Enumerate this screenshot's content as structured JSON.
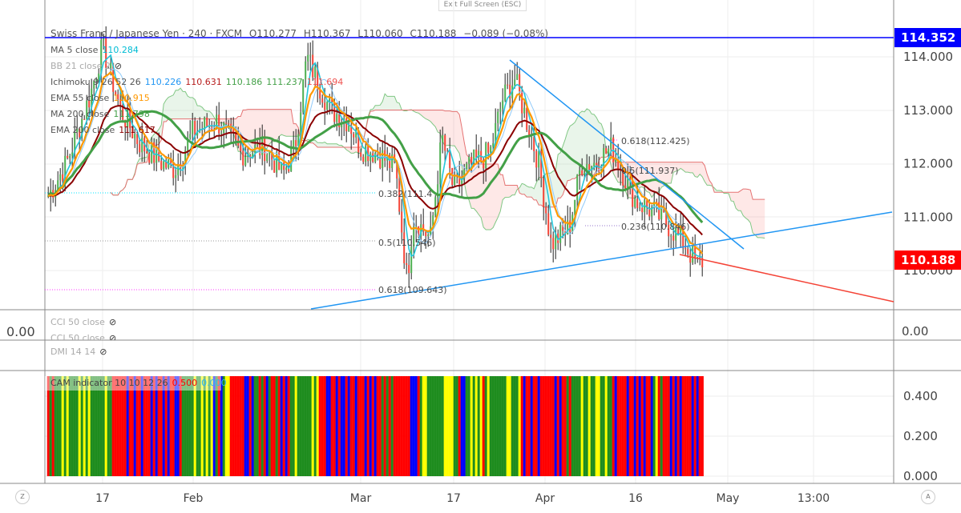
{
  "toolbar": {
    "exit_fullscreen": "Exit Full Screen (ESC)",
    "left_circle": "Z",
    "right_circle": "A"
  },
  "header": {
    "title": "Swiss Franc / Japanese Yen · 240 · FXCM",
    "open": "O110.277",
    "high": "H110.367",
    "low": "L110.060",
    "close": "C110.188",
    "change": "−0.089 (−0.08%)"
  },
  "indicators": [
    {
      "label": "MA 5 close",
      "values": [
        "110.284"
      ],
      "colors": [
        "#00bcd4"
      ]
    },
    {
      "label": "BB 21 close 2",
      "values": [],
      "hidden": true
    },
    {
      "label": "Ichimoku 9 26 52 26",
      "values": [
        "110.226",
        "110.631",
        "110.186",
        "111.237",
        "111.694"
      ],
      "colors": [
        "#2196f3",
        "#b71c1c",
        "#43a047",
        "#43a047",
        "#ef5350"
      ]
    },
    {
      "label": "EMA 55 close",
      "values": [
        "110.915"
      ],
      "colors": [
        "#ff9800"
      ]
    },
    {
      "label": "MA 200 close",
      "values": [
        "111.798"
      ],
      "colors": [
        "#43a047"
      ]
    },
    {
      "label": "EMA 200 close",
      "values": [
        "111.617"
      ],
      "colors": [
        "#8b0000"
      ]
    }
  ],
  "panes": {
    "cci1": "CCI 50 close",
    "cci2": "CCI 50 close",
    "dmi": "DMI 14 14",
    "cam": {
      "label": "CAM indicator 10 10 12 26",
      "v1": "0.500",
      "v2": "0.000"
    },
    "cci_axis": "0.00"
  },
  "price_tags": {
    "line": "114.352",
    "last": "110.188",
    "line_color": "#0000ff",
    "last_color": "#ff0000"
  },
  "fib_labels": [
    {
      "text": "0.382(111.4",
      "color": "#00e5ff"
    },
    {
      "text": "0.5(110.546)",
      "color": "#33dd33"
    },
    {
      "text": "0.618(109.643)",
      "color": "#ff33ff"
    },
    {
      "text": "0.618(112.425)",
      "color": "#ff33ff"
    },
    {
      "text": "0.5(111.937)",
      "color": "#33dd33"
    },
    {
      "text": "0.236(110.846)",
      "color": "#9575cd"
    }
  ],
  "chart_data": {
    "type": "candlestick",
    "y_axis": {
      "ticks": [
        "114.000",
        "113.000",
        "112.000",
        "111.000",
        "110.000"
      ],
      "range": [
        109.3,
        114.6
      ]
    },
    "cam_axis": {
      "ticks": [
        "0.400",
        "0.200",
        "0.000"
      ]
    },
    "x_ticks": [
      "17",
      "Feb",
      "Mar",
      "17",
      "Apr",
      "16",
      "May",
      "13:00"
    ],
    "grid": true,
    "approx_close_path": [
      [
        "Jan 8",
        111.4
      ],
      [
        "Jan 11",
        112.0
      ],
      [
        "Jan 15",
        113.3
      ],
      [
        "Jan 17",
        114.2
      ],
      [
        "Jan 20",
        113.0
      ],
      [
        "Jan 23",
        112.4
      ],
      [
        "Jan 27",
        112.0
      ],
      [
        "Jan 29",
        111.9
      ],
      [
        "Feb 1",
        112.6
      ],
      [
        "Feb 5",
        112.8
      ],
      [
        "Feb 9",
        112.2
      ],
      [
        "Feb 13",
        112.3
      ],
      [
        "Feb 16",
        111.8
      ],
      [
        "Feb 18",
        112.3
      ],
      [
        "Feb 20",
        114.0
      ],
      [
        "Feb 22",
        113.5
      ],
      [
        "Feb 24",
        113.0
      ],
      [
        "Feb 27",
        112.8
      ],
      [
        "Mar 1",
        112.3
      ],
      [
        "Mar 4",
        112.2
      ],
      [
        "Mar 7",
        111.9
      ],
      [
        "Mar 9",
        109.8
      ],
      [
        "Mar 10",
        111.0
      ],
      [
        "Mar 13",
        110.6
      ],
      [
        "Mar 15",
        112.5
      ],
      [
        "Mar 17",
        111.5
      ],
      [
        "Mar 20",
        112.0
      ],
      [
        "Mar 23",
        112.2
      ],
      [
        "Mar 25",
        113.2
      ],
      [
        "Mar 27",
        113.6
      ],
      [
        "Mar 29",
        112.8
      ],
      [
        "Mar 31",
        112.0
      ],
      [
        "Apr 2",
        110.5
      ],
      [
        "Apr 5",
        110.8
      ],
      [
        "Apr 7",
        112.0
      ],
      [
        "Apr 9",
        112.0
      ],
      [
        "Apr 12",
        112.3
      ],
      [
        "Apr 14",
        111.8
      ],
      [
        "Apr 16",
        111.3
      ],
      [
        "Apr 19",
        111.1
      ],
      [
        "Apr 21",
        110.9
      ],
      [
        "Apr 24",
        110.5
      ],
      [
        "Apr 26",
        110.1
      ],
      [
        "Apr 27",
        110.188
      ]
    ],
    "horizontal_line": 114.352,
    "last_price": 110.188
  }
}
